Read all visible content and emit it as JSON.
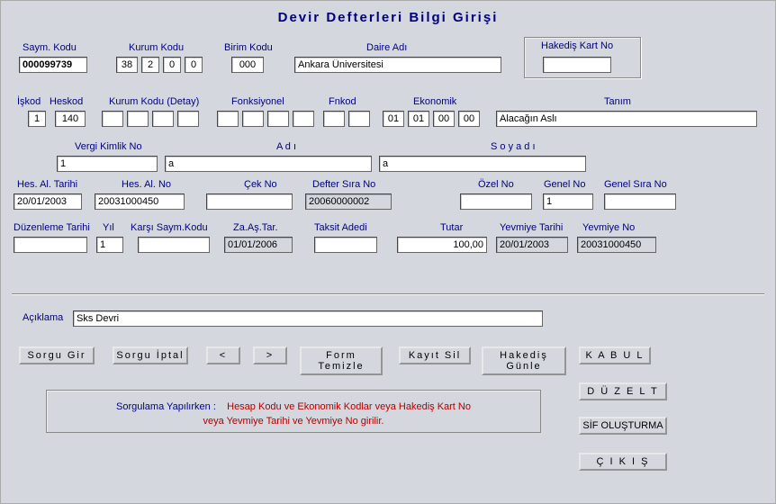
{
  "title": "Devir Defterleri Bilgi Girişi",
  "row1": {
    "saym_kodu_label": "Saym. Kodu",
    "saym_kodu": "000099739",
    "kurum_kodu_label": "Kurum Kodu",
    "kurum1": "38",
    "kurum2": "2",
    "kurum3": "0",
    "kurum4": "0",
    "birim_kodu_label": "Birim Kodu",
    "birim_kodu": "000",
    "daire_adi_label": "Daire Adı",
    "daire_adi": "Ankara Üniversitesi",
    "hakedis_label": "Hakediş Kart No",
    "hakedis": ""
  },
  "row2": {
    "iskod_label": "İşkod",
    "iskod": "1",
    "heskod_label": "Heskod",
    "heskod": "140",
    "kurum_detay_label": "Kurum Kodu (Detay)",
    "kd1": "",
    "kd2": "",
    "kd3": "",
    "kd4": "",
    "fonksiyonel_label": "Fonksiyonel",
    "fn1": "",
    "fn2": "",
    "fn3": "",
    "fn4": "",
    "fnkod_label": "Fnkod",
    "fnkod1": "",
    "fnkod2": "",
    "ekonomik_label": "Ekonomik",
    "ek1": "01",
    "ek2": "01",
    "ek3": "00",
    "ek4": "00",
    "tanim_label": "Tanım",
    "tanim": "Alacağın Aslı"
  },
  "row3": {
    "vergi_label": "Vergi Kimlik No",
    "vergi": "1",
    "adi_label": "A d ı",
    "adi": "a",
    "soyadi_label": "S o y a d ı",
    "soyadi": "a"
  },
  "row4": {
    "hes_al_tarihi_label": "Hes. Al. Tarihi",
    "hes_al_tarihi": "20/01/2003",
    "hes_al_no_label": "Hes. Al. No",
    "hes_al_no": "20031000450",
    "cek_no_label": "Çek No",
    "cek_no": "",
    "defter_sira_label": "Defter Sıra No",
    "defter_sira": "20060000002",
    "ozel_no_label": "Özel No",
    "ozel_no": "",
    "genel_no_label": "Genel No",
    "genel_no": "1",
    "genel_sira_label": "Genel Sıra No",
    "genel_sira": ""
  },
  "row5": {
    "duzenleme_label": "Düzenleme Tarihi",
    "duzenleme": "",
    "yil_label": "Yıl",
    "yil": "1",
    "karsi_label": "Karşı Saym.Kodu",
    "karsi": "",
    "zaastar_label": "Za.Aş.Tar.",
    "zaastar": "01/01/2006",
    "taksit_label": "Taksit Adedi",
    "taksit": "",
    "tutar_label": "Tutar",
    "tutar": "100,00",
    "yevmiye_tarihi_label": "Yevmiye Tarihi",
    "yevmiye_tarihi": "20/01/2003",
    "yevmiye_no_label": "Yevmiye No",
    "yevmiye_no": "20031000450"
  },
  "aciklama_label": "Açıklama",
  "aciklama": "Sks Devri",
  "buttons": {
    "sorgu_gir": "Sorgu Gir",
    "sorgu_iptal": "Sorgu İptal",
    "prev": "<",
    "next": ">",
    "form_temizle": "Form Temizle",
    "kayit_sil": "Kayıt Sil",
    "hakedis_gunle": "Hakediş Günle",
    "kabul": "K A B U L",
    "duzelt": "D Ü Z E L T",
    "sif_olusturma": "SİF OLUŞTURMA",
    "cikis": "Ç I K I Ş"
  },
  "sorgu_note": {
    "prefix": "Sorgulama Yapılırken :",
    "line1": "Hesap Kodu ve Ekonomik Kodlar  veya    Hakediş Kart No",
    "line2": "veya   Yevmiye Tarihi ve Yevmiye No  girilir."
  }
}
